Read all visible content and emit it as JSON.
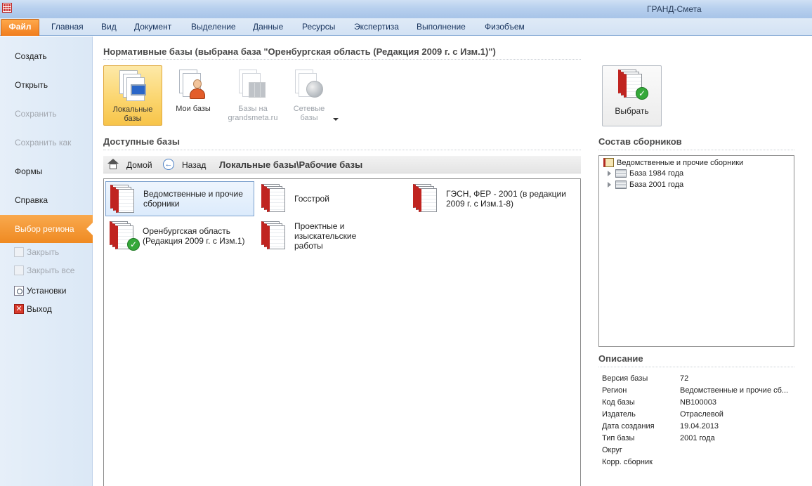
{
  "window": {
    "title": "ГРАНД-Смета"
  },
  "ribbon": {
    "file_tab": "Файл",
    "tabs": [
      "Главная",
      "Вид",
      "Документ",
      "Выделение",
      "Данные",
      "Ресурсы",
      "Экспертиза",
      "Выполнение",
      "Физобъем"
    ]
  },
  "left_menu": {
    "items": [
      "Создать",
      "Открыть",
      "Сохранить",
      "Сохранить как",
      "Формы",
      "Справка"
    ],
    "active": "Выбор региона",
    "small_items": [
      "Закрыть",
      "Закрыть все",
      "Установки",
      "Выход"
    ]
  },
  "normative": {
    "title": "Нормативные базы (выбрана база \"Оренбургская область (Редакция 2009 г. с Изм.1)\")",
    "buttons": [
      {
        "line1": "Локальные",
        "line2": "базы"
      },
      {
        "line1": "Мои базы",
        "line2": ""
      },
      {
        "line1": "Базы на",
        "line2": "grandsmeta.ru"
      },
      {
        "line1": "Сетевые",
        "line2": "базы"
      }
    ]
  },
  "available": {
    "title": "Доступные базы",
    "home": "Домой",
    "back": "Назад",
    "path": "Локальные базы\\Рабочие базы",
    "items": [
      {
        "line1": "Ведомственные и прочие",
        "line2": "сборники"
      },
      {
        "line1": "Госстрой",
        "line2": ""
      },
      {
        "line1": "ГЭСН, ФЕР - 2001 (в редакции",
        "line2": "2009 г. с Изм.1-8)"
      },
      {
        "line1": "Оренбургская область",
        "line2": "(Редакция 2009 г. с Изм.1)"
      },
      {
        "line1": "Проектные и изыскательские",
        "line2": "работы"
      }
    ]
  },
  "right": {
    "select_button": "Выбрать",
    "contents_title": "Состав сборников",
    "tree": {
      "root": "Ведомственные и прочие сборники",
      "children": [
        "База 1984 года",
        "База 2001 года"
      ]
    },
    "description_title": "Описание",
    "description": [
      {
        "key": "Версия базы",
        "value": "72"
      },
      {
        "key": "Регион",
        "value": "Ведомственные и прочие сб..."
      },
      {
        "key": "Код базы",
        "value": "NB100003"
      },
      {
        "key": "Издатель",
        "value": "Отраслевой"
      },
      {
        "key": "Дата создания",
        "value": "19.04.2013"
      },
      {
        "key": "Тип базы",
        "value": "2001 года"
      },
      {
        "key": "Округ",
        "value": ""
      },
      {
        "key": "Корр. сборник",
        "value": ""
      }
    ]
  }
}
